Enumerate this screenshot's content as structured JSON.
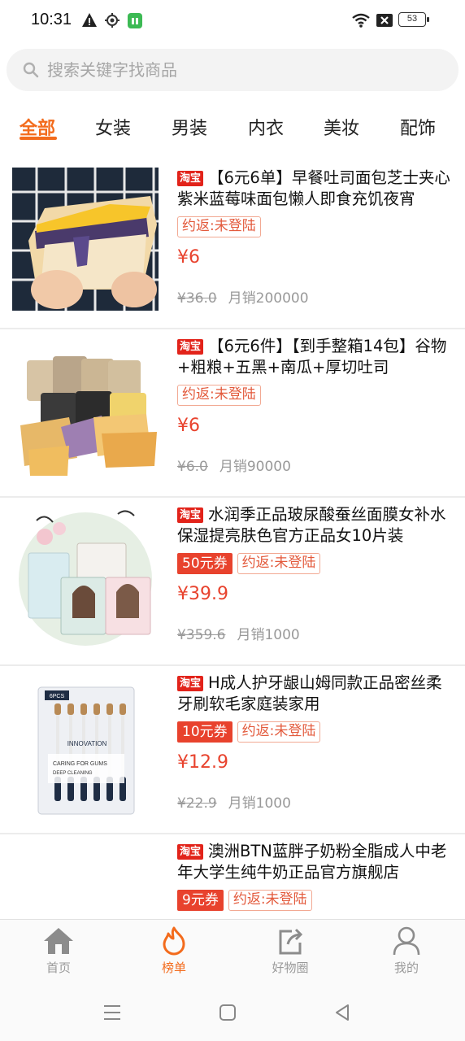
{
  "status_bar": {
    "time": "10:31",
    "battery": "53"
  },
  "search": {
    "placeholder": "搜索关键字找商品"
  },
  "tabs": [
    {
      "label": "全部",
      "active": true
    },
    {
      "label": "女装",
      "active": false
    },
    {
      "label": "男装",
      "active": false
    },
    {
      "label": "内衣",
      "active": false
    },
    {
      "label": "美妆",
      "active": false
    },
    {
      "label": "配饰",
      "active": false
    }
  ],
  "products": [
    {
      "platform": "淘宝",
      "title": "【6元6单】早餐吐司面包芝士夹心紫米蓝莓味面包懒人即食充饥夜宵",
      "coupon": "",
      "rebate": "约返:未登陆",
      "price": "¥6",
      "original_price": "¥36.0",
      "sales": "月销200000"
    },
    {
      "platform": "淘宝",
      "title": "【6元6件】【到手整箱14包】谷物+粗粮+五黑+南瓜+厚切吐司",
      "coupon": "",
      "rebate": "约返:未登陆",
      "price": "¥6",
      "original_price": "¥6.0",
      "sales": "月销90000"
    },
    {
      "platform": "淘宝",
      "title": "水润季正品玻尿酸蚕丝面膜女补水保湿提亮肤色官方正品女10片装",
      "coupon": "50元券",
      "rebate": "约返:未登陆",
      "price": "¥39.9",
      "original_price": "¥359.6",
      "sales": "月销1000"
    },
    {
      "platform": "淘宝",
      "title": "H成人护牙龈山姆同款正品密丝柔牙刷软毛家庭装家用",
      "coupon": "10元券",
      "rebate": "约返:未登陆",
      "price": "¥12.9",
      "original_price": "¥22.9",
      "sales": "月销1000",
      "image_text": {
        "pack": "6PCS",
        "line1": "INNOVATION",
        "line2": "CARING FOR GUMS",
        "line3": "DEEP CLEANING"
      }
    },
    {
      "platform": "淘宝",
      "title": "澳洲BTN蓝胖子奶粉全脂成人中老年大学生纯牛奶正品官方旗舰店",
      "coupon": "9元券",
      "rebate": "约返:未登陆",
      "price": "",
      "original_price": "",
      "sales": ""
    }
  ],
  "bottom_nav": [
    {
      "label": "首页",
      "icon": "home-icon",
      "active": false
    },
    {
      "label": "榜单",
      "icon": "flame-icon",
      "active": true
    },
    {
      "label": "好物圈",
      "icon": "share-icon",
      "active": false
    },
    {
      "label": "我的",
      "icon": "user-icon",
      "active": false
    }
  ],
  "colors": {
    "accent": "#f36b1c",
    "price": "#e8422d",
    "taobao_badge": "#e2231a"
  }
}
